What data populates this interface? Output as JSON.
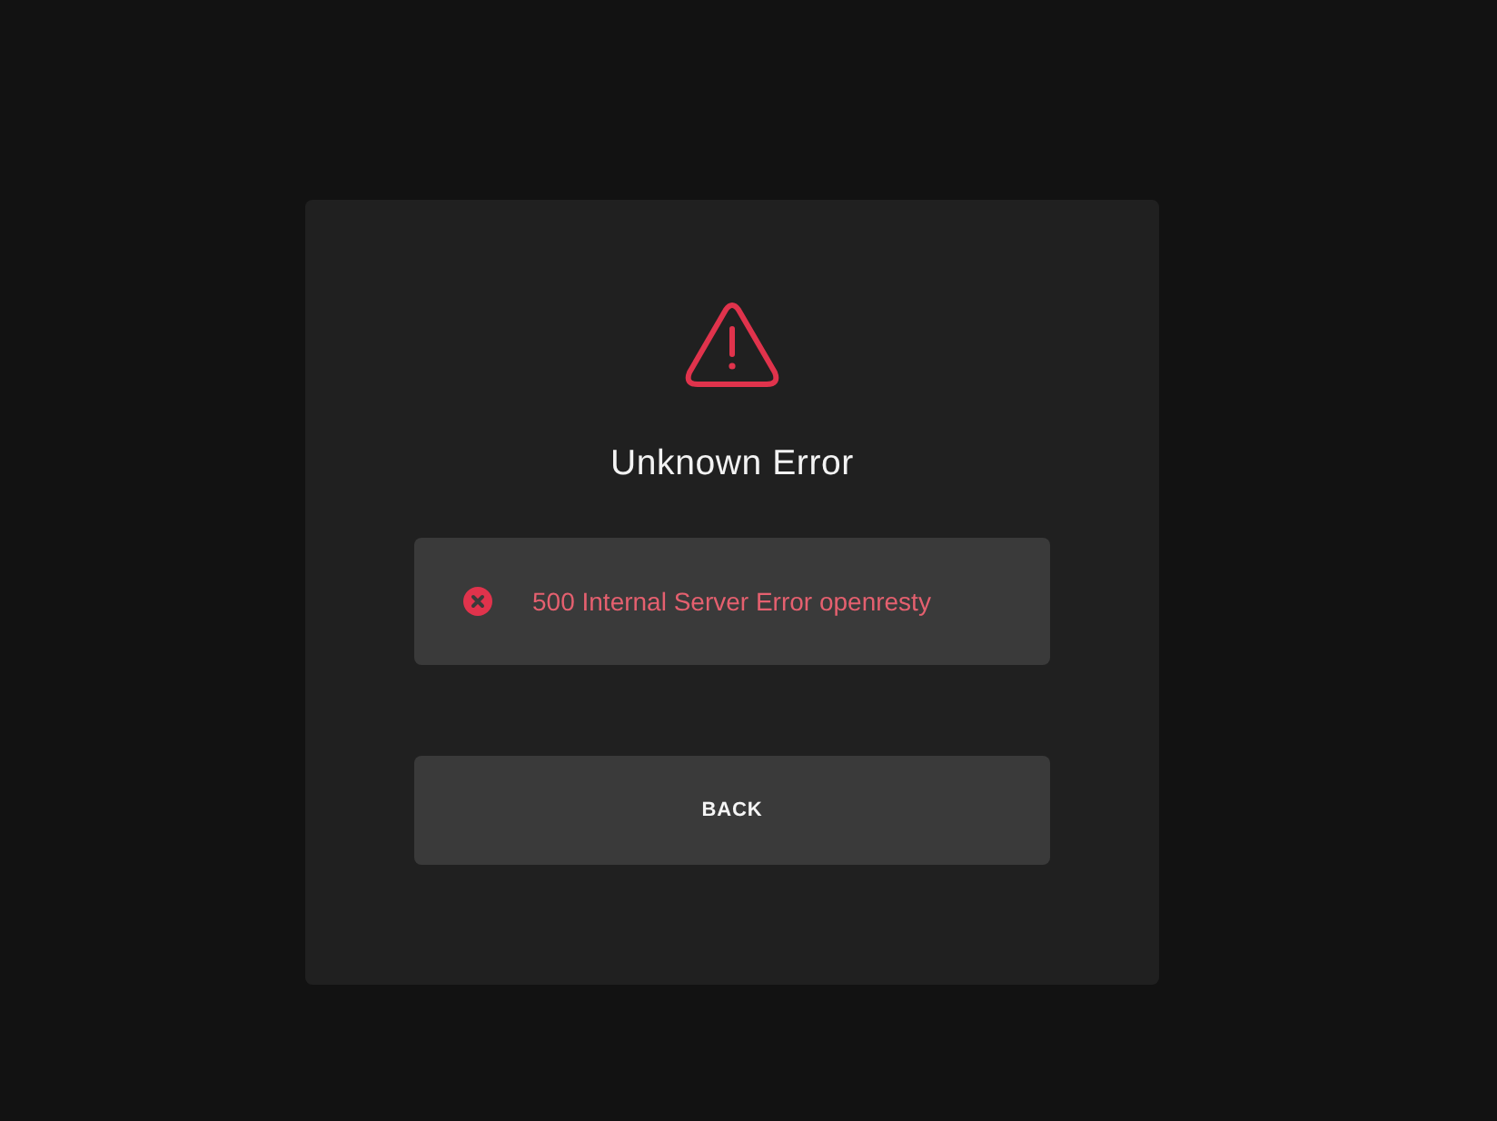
{
  "dialog": {
    "title": "Unknown Error",
    "error": {
      "message": "500 Internal Server Error openresty"
    },
    "buttons": [
      {
        "label": "BACK"
      }
    ]
  }
}
